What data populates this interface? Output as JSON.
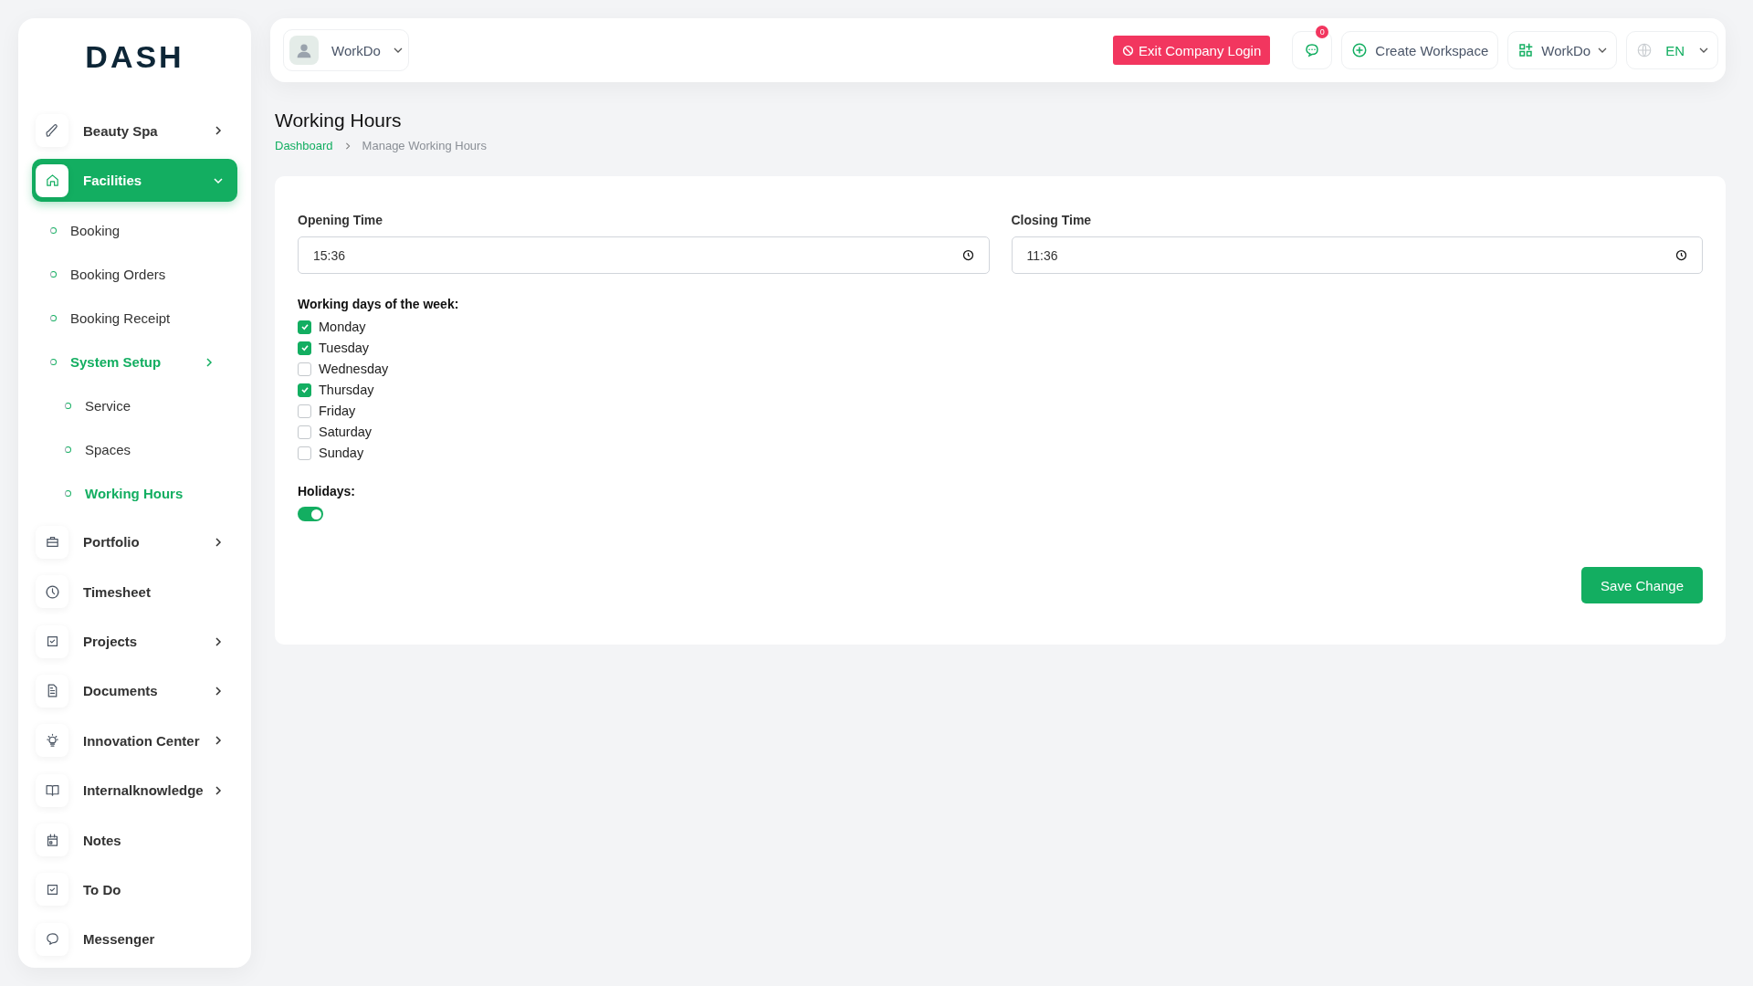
{
  "logo": {
    "text": "DASH"
  },
  "sidebar": {
    "items": [
      {
        "label": "Beauty Spa",
        "selected": false,
        "open": false
      },
      {
        "label": "Facilities",
        "selected": true,
        "open": true,
        "children": [
          {
            "label": "Booking",
            "selected": false
          },
          {
            "label": "Booking Orders",
            "selected": false
          },
          {
            "label": "Booking Receipt",
            "selected": false
          },
          {
            "label": "System Setup",
            "selected": true,
            "open": false,
            "children": [
              {
                "label": "Service",
                "selected": false
              },
              {
                "label": "Spaces",
                "selected": false
              },
              {
                "label": "Working Hours",
                "selected": true
              }
            ]
          }
        ]
      },
      {
        "label": "Portfolio",
        "selected": false,
        "open": false
      },
      {
        "label": "Timesheet",
        "selected": false
      },
      {
        "label": "Projects",
        "selected": false,
        "open": false
      },
      {
        "label": "Documents",
        "selected": false,
        "open": false
      },
      {
        "label": "Innovation Center",
        "selected": false,
        "open": false
      },
      {
        "label": "Internalknowledge",
        "selected": false,
        "open": false
      },
      {
        "label": "Notes",
        "selected": false
      },
      {
        "label": "To Do",
        "selected": false
      },
      {
        "label": "Messenger",
        "selected": false
      }
    ]
  },
  "header": {
    "user_menu": {
      "name": "WorkDo"
    },
    "exit_button": "Exit Company Login",
    "messages": {
      "badge": "0"
    },
    "create_workspace": "Create Workspace",
    "workspace_menu": "WorkDo",
    "language_menu": "EN"
  },
  "page": {
    "title": "Working Hours",
    "breadcrumbs": [
      {
        "label": "Dashboard",
        "kind": "link"
      },
      {
        "label": "Manage Working Hours",
        "kind": "current"
      }
    ]
  },
  "form": {
    "opening_time": {
      "label": "Opening Time",
      "value": "15:36"
    },
    "closing_time": {
      "label": "Closing Time",
      "value": "11:36"
    },
    "working_days": {
      "label": "Working days of the week:",
      "items": [
        {
          "label": "Monday",
          "checked": true
        },
        {
          "label": "Tuesday",
          "checked": true
        },
        {
          "label": "Wednesday",
          "checked": false
        },
        {
          "label": "Thursday",
          "checked": true
        },
        {
          "label": "Friday",
          "checked": false
        },
        {
          "label": "Saturday",
          "checked": false
        },
        {
          "label": "Sunday",
          "checked": false
        }
      ]
    },
    "holidays": {
      "label": "Holidays:",
      "on": true
    },
    "save_button": "Save Change"
  }
}
